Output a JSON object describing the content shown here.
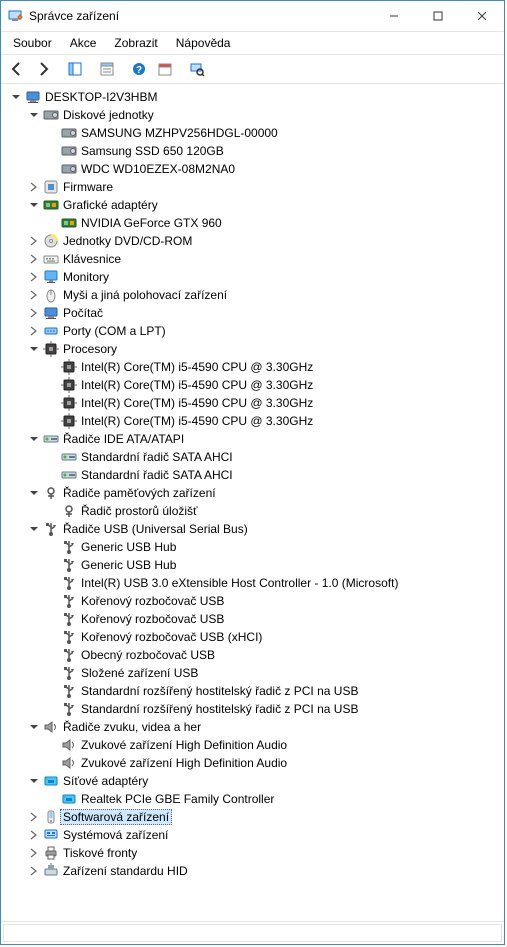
{
  "window": {
    "title": "Správce zařízení"
  },
  "menu": {
    "file": "Soubor",
    "actions": "Akce",
    "view": "Zobrazit",
    "help": "Nápověda"
  },
  "tree": [
    {
      "depth": 0,
      "state": "open",
      "icon": "computer",
      "label": "DESKTOP-I2V3HBM"
    },
    {
      "depth": 1,
      "state": "open",
      "icon": "disk",
      "label": "Diskové jednotky"
    },
    {
      "depth": 2,
      "state": "leaf",
      "icon": "disk",
      "label": "SAMSUNG MZHPV256HDGL-00000"
    },
    {
      "depth": 2,
      "state": "leaf",
      "icon": "disk",
      "label": "Samsung SSD 650 120GB"
    },
    {
      "depth": 2,
      "state": "leaf",
      "icon": "disk",
      "label": "WDC WD10EZEX-08M2NA0"
    },
    {
      "depth": 1,
      "state": "closed",
      "icon": "firmware",
      "label": "Firmware"
    },
    {
      "depth": 1,
      "state": "open",
      "icon": "gpu",
      "label": "Grafické adaptéry"
    },
    {
      "depth": 2,
      "state": "leaf",
      "icon": "gpu",
      "label": "NVIDIA GeForce GTX 960"
    },
    {
      "depth": 1,
      "state": "closed",
      "icon": "dvd",
      "label": "Jednotky DVD/CD-ROM"
    },
    {
      "depth": 1,
      "state": "closed",
      "icon": "keyboard",
      "label": "Klávesnice"
    },
    {
      "depth": 1,
      "state": "closed",
      "icon": "monitor",
      "label": "Monitory"
    },
    {
      "depth": 1,
      "state": "closed",
      "icon": "mouse",
      "label": "Myši a jiná polohovací zařízení"
    },
    {
      "depth": 1,
      "state": "closed",
      "icon": "computer",
      "label": "Počítač"
    },
    {
      "depth": 1,
      "state": "closed",
      "icon": "port",
      "label": "Porty (COM a LPT)"
    },
    {
      "depth": 1,
      "state": "open",
      "icon": "cpu",
      "label": "Procesory"
    },
    {
      "depth": 2,
      "state": "leaf",
      "icon": "cpu",
      "label": "Intel(R) Core(TM) i5-4590 CPU @ 3.30GHz"
    },
    {
      "depth": 2,
      "state": "leaf",
      "icon": "cpu",
      "label": "Intel(R) Core(TM) i5-4590 CPU @ 3.30GHz"
    },
    {
      "depth": 2,
      "state": "leaf",
      "icon": "cpu",
      "label": "Intel(R) Core(TM) i5-4590 CPU @ 3.30GHz"
    },
    {
      "depth": 2,
      "state": "leaf",
      "icon": "cpu",
      "label": "Intel(R) Core(TM) i5-4590 CPU @ 3.30GHz"
    },
    {
      "depth": 1,
      "state": "open",
      "icon": "ide",
      "label": "Řadiče IDE ATA/ATAPI"
    },
    {
      "depth": 2,
      "state": "leaf",
      "icon": "ide",
      "label": "Standardní řadič  SATA AHCI"
    },
    {
      "depth": 2,
      "state": "leaf",
      "icon": "ide",
      "label": "Standardní řadič  SATA AHCI"
    },
    {
      "depth": 1,
      "state": "open",
      "icon": "storage",
      "label": "Řadiče paměťových zařízení"
    },
    {
      "depth": 2,
      "state": "leaf",
      "icon": "storage",
      "label": "Řadič prostorů úložišť"
    },
    {
      "depth": 1,
      "state": "open",
      "icon": "usb",
      "label": "Řadiče USB (Universal Serial Bus)"
    },
    {
      "depth": 2,
      "state": "leaf",
      "icon": "usb",
      "label": "Generic USB Hub"
    },
    {
      "depth": 2,
      "state": "leaf",
      "icon": "usb",
      "label": "Generic USB Hub"
    },
    {
      "depth": 2,
      "state": "leaf",
      "icon": "usb",
      "label": "Intel(R) USB 3.0 eXtensible Host Controller - 1.0 (Microsoft)"
    },
    {
      "depth": 2,
      "state": "leaf",
      "icon": "usb",
      "label": "Kořenový rozbočovač USB"
    },
    {
      "depth": 2,
      "state": "leaf",
      "icon": "usb",
      "label": "Kořenový rozbočovač USB"
    },
    {
      "depth": 2,
      "state": "leaf",
      "icon": "usb",
      "label": "Kořenový rozbočovač USB (xHCI)"
    },
    {
      "depth": 2,
      "state": "leaf",
      "icon": "usb",
      "label": "Obecný rozbočovač USB"
    },
    {
      "depth": 2,
      "state": "leaf",
      "icon": "usb",
      "label": "Složené zařízení USB"
    },
    {
      "depth": 2,
      "state": "leaf",
      "icon": "usb",
      "label": "Standardní rozšířený hostitelský řadič z PCI na USB"
    },
    {
      "depth": 2,
      "state": "leaf",
      "icon": "usb",
      "label": "Standardní rozšířený hostitelský řadič z PCI na USB"
    },
    {
      "depth": 1,
      "state": "open",
      "icon": "audio",
      "label": "Řadiče zvuku, videa a her"
    },
    {
      "depth": 2,
      "state": "leaf",
      "icon": "audio",
      "label": "Zvukové zařízení High Definition Audio"
    },
    {
      "depth": 2,
      "state": "leaf",
      "icon": "audio",
      "label": "Zvukové zařízení High Definition Audio"
    },
    {
      "depth": 1,
      "state": "open",
      "icon": "network",
      "label": "Síťové adaptéry"
    },
    {
      "depth": 2,
      "state": "leaf",
      "icon": "network",
      "label": "Realtek PCIe GBE Family Controller"
    },
    {
      "depth": 1,
      "state": "closed",
      "icon": "software",
      "label": "Softwarová zařízení",
      "selected": true
    },
    {
      "depth": 1,
      "state": "closed",
      "icon": "system",
      "label": "Systémová zařízení"
    },
    {
      "depth": 1,
      "state": "closed",
      "icon": "printer",
      "label": "Tiskové fronty"
    },
    {
      "depth": 1,
      "state": "closed",
      "icon": "hid",
      "label": "Zařízení standardu HID"
    }
  ]
}
